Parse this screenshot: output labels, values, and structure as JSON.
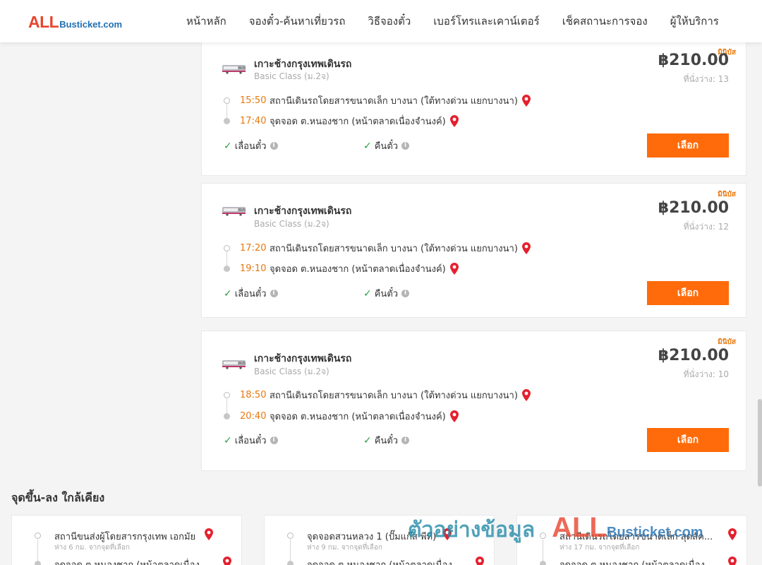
{
  "header": {
    "logo_all": "ALL",
    "logo_rest": "Busticket.com",
    "nav": [
      "หน้าหลัก",
      "จองตั๋ว-ค้นหาเที่ยวรถ",
      "วิธีจองตั๋ว",
      "เบอร์โทรและเคาน์เตอร์",
      "เช็คสถานะการจอง",
      "ผู้ให้บริการ"
    ]
  },
  "trips": [
    {
      "badge": "มินิบัส",
      "route": "เกาะช้างกรุงเทพเดินรถ",
      "bus_class": "Basic Class (ม.2จ)",
      "price": "฿210.00",
      "seats": "ที่นั่งว่าง: 13",
      "depart_time": "15:50",
      "depart_place": "สถานีเดินรถโดยสารขนาดเล็ก บางนา (ใต้ทางด่วน แยกบางนา)",
      "arrive_time": "17:40",
      "arrive_place": "จุดจอด ต.หนองชาก (หน้าตลาดเนื่องจำนงค์)",
      "feature_1": "เลื่อนตั๋ว",
      "feature_2": "คืนตั๋ว",
      "select_label": "เลือก"
    },
    {
      "badge": "มินิบัส",
      "route": "เกาะช้างกรุงเทพเดินรถ",
      "bus_class": "Basic Class (ม.2จ)",
      "price": "฿210.00",
      "seats": "ที่นั่งว่าง: 12",
      "depart_time": "17:20",
      "depart_place": "สถานีเดินรถโดยสารขนาดเล็ก บางนา (ใต้ทางด่วน แยกบางนา)",
      "arrive_time": "19:10",
      "arrive_place": "จุดจอด ต.หนองชาก (หน้าตลาดเนื่องจำนงค์)",
      "feature_1": "เลื่อนตั๋ว",
      "feature_2": "คืนตั๋ว",
      "select_label": "เลือก"
    },
    {
      "badge": "มินิบัส",
      "route": "เกาะช้างกรุงเทพเดินรถ",
      "bus_class": "Basic Class (ม.2จ)",
      "price": "฿210.00",
      "seats": "ที่นั่งว่าง: 10",
      "depart_time": "18:50",
      "depart_place": "สถานีเดินรถโดยสารขนาดเล็ก บางนา (ใต้ทางด่วน แยกบางนา)",
      "arrive_time": "20:40",
      "arrive_place": "จุดจอด ต.หนองชาก (หน้าตลาดเนื่องจำนงค์)",
      "feature_1": "เลื่อนตั๋ว",
      "feature_2": "คืนตั๋ว",
      "select_label": "เลือก"
    }
  ],
  "nearby": {
    "title": "จุดขึ้น-ลง ใกล้เคียง",
    "cards": [
      {
        "from": "สถานีขนส่งผู้โดยสารกรุงเทพ เอกมัย",
        "distance": "ห่าง 6 กม. จากจุดที่เลือก",
        "to": "จุดจอด ต.หนองชาก (หน้าตลาดเนื่อง"
      },
      {
        "from": "จุดจอดสวนหลวง 1 (ปั๊มแก๊ส พีที)",
        "distance": "ห่าง 9 กม. จากจุดที่เลือก",
        "to": "จุดจอด ต.หนองชาก (หน้าตลาดเนื่อง"
      },
      {
        "from": "สถานีเดินรถโดยสารขนาดเล็ก สุดสัค...",
        "distance": "ห่าง 17 กม. จากจุดที่เลือก",
        "to": "จุดจอด ต.หนองชาก (หน้าตลาดเนื่อง"
      }
    ]
  },
  "watermark": {
    "text": "ตัวอย่างข้อมูล",
    "all": "ALL",
    "rest": "Busticket.com"
  }
}
